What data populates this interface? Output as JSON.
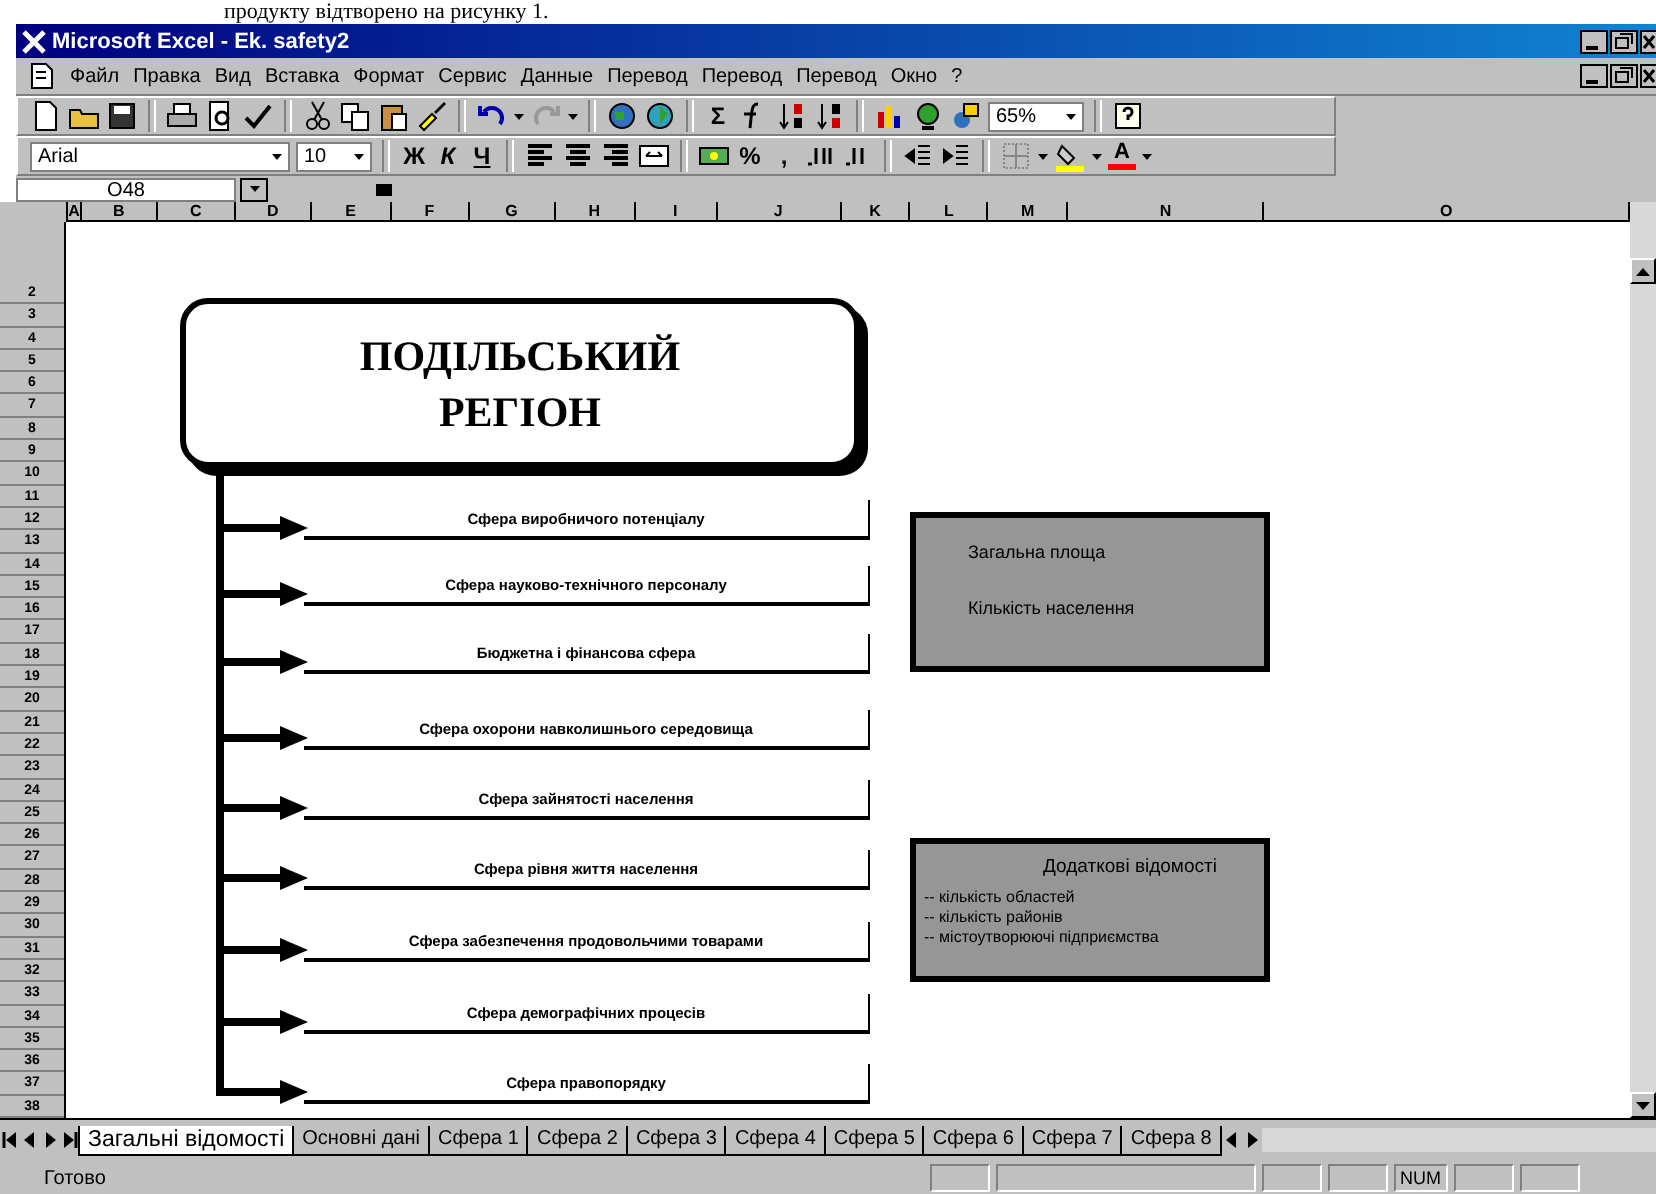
{
  "document_text": "продукту відтворено на рисунку 1.",
  "window": {
    "title": "Microsoft Excel - Ek. safety2"
  },
  "menu": [
    {
      "label": "Файл"
    },
    {
      "label": "Правка"
    },
    {
      "label": "Вид"
    },
    {
      "label": "Вставка"
    },
    {
      "label": "Формат"
    },
    {
      "label": "Сервис"
    },
    {
      "label": "Данные"
    },
    {
      "label": "Перевод"
    },
    {
      "label": "Перевод"
    },
    {
      "label": "Перевод"
    },
    {
      "label": "Окно"
    },
    {
      "label": "?"
    }
  ],
  "standard_toolbar": {
    "sum": "Σ",
    "zoom": "65%"
  },
  "formatting_toolbar": {
    "font": "Arial",
    "size": "10",
    "bold": "Ж",
    "italic": "К",
    "underline": "Ч",
    "percent": "%",
    "comma": ",",
    "font_color": "A"
  },
  "name_box": "O48",
  "columns": [
    "A",
    "B",
    "C",
    "D",
    "E",
    "F",
    "G",
    "H",
    "I",
    "J",
    "K",
    "L",
    "M",
    "N",
    "O"
  ],
  "rows": [
    "2",
    "3",
    "4",
    "5",
    "6",
    "7",
    "8",
    "9",
    "10",
    "11",
    "12",
    "13",
    "14",
    "15",
    "16",
    "17",
    "18",
    "19",
    "20",
    "21",
    "22",
    "23",
    "24",
    "25",
    "26",
    "27",
    "28",
    "29",
    "30",
    "31",
    "32",
    "33",
    "34",
    "35",
    "36",
    "37",
    "38"
  ],
  "diagram": {
    "title_lines": [
      "ПОДІЛЬСЬКИЙ",
      "РЕГІОН"
    ],
    "spheres": [
      "Сфера виробничого потенціалу",
      "Сфера науково-технічного персоналу",
      "Бюджетна і фінансова сфера",
      "Сфера охорони навколишнього середовища",
      "Сфера зайнятості населення",
      "Сфера рівня життя населення",
      "Сфера забезпечення продовольчими товарами",
      "Сфера демографічних процесів",
      "Сфера правопорядку"
    ],
    "info_boxes": [
      {
        "kind": "plain",
        "lines": [
          "Загальна площа",
          "Кількість населення"
        ]
      },
      {
        "kind": "headed",
        "heading": "Додаткові відомості",
        "lines": [
          "-- кількість областей",
          "-- кількість районів",
          "-- містоутворюючі підприємства"
        ]
      }
    ]
  },
  "sheet_tabs": [
    {
      "label": "Загальні відомості",
      "selected": true
    },
    {
      "label": "Основні дані",
      "selected": false
    },
    {
      "label": "Сфера 1",
      "selected": false
    },
    {
      "label": "Сфера 2",
      "selected": false
    },
    {
      "label": "Сфера 3",
      "selected": false
    },
    {
      "label": "Сфера 4",
      "selected": false
    },
    {
      "label": "Сфера 5",
      "selected": false
    },
    {
      "label": "Сфера 6",
      "selected": false
    },
    {
      "label": "Сфера 7",
      "selected": false
    },
    {
      "label": "Сфера 8",
      "selected": false
    }
  ],
  "status_bar": {
    "text": "Готово",
    "indicator": "NUM"
  }
}
